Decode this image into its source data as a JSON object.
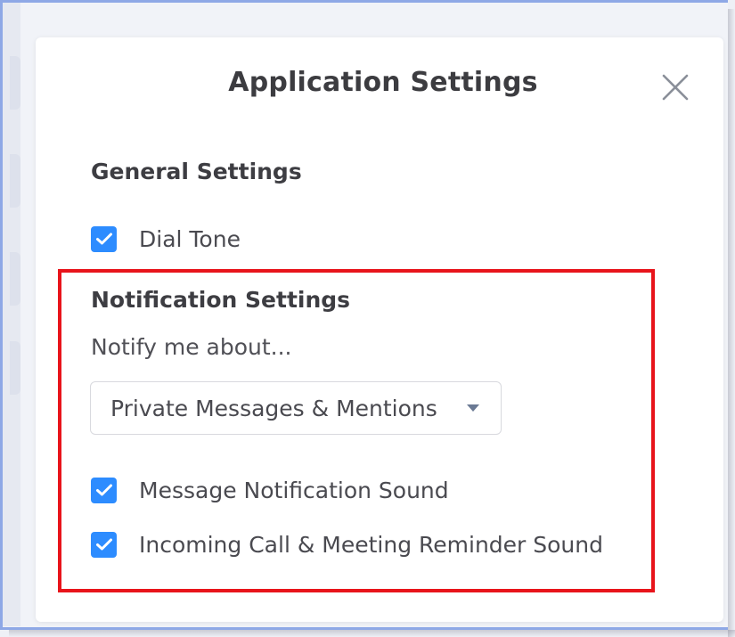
{
  "dialog": {
    "title": "Application Settings",
    "close_icon": "close-icon"
  },
  "general": {
    "heading": "General Settings",
    "dial_tone": {
      "label": "Dial Tone",
      "checked": true
    }
  },
  "notification": {
    "heading": "Notification Settings",
    "hint": "Notify me about...",
    "dropdown": {
      "selected": "Private Messages & Mentions"
    },
    "message_sound": {
      "label": "Message Notification Sound",
      "checked": true
    },
    "call_sound": {
      "label": "Incoming Call & Meeting Reminder Sound",
      "checked": true
    }
  },
  "colors": {
    "checkbox": "#2d8cff",
    "highlight": "#e8141b",
    "window_border": "#8ea8e6"
  }
}
